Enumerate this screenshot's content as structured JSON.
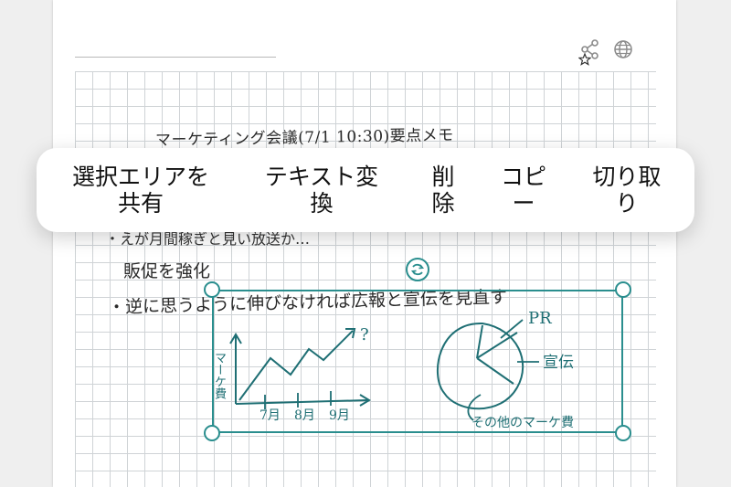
{
  "note": {
    "title": "マーケティング会議(7/1 10:30)要点メモ",
    "line_note_1": "・えが月間稼ぎと見い放送か…",
    "line_note_2": "販促を強化",
    "line_note_3": "・逆に思うように伸びなければ広報と宣伝を見直す"
  },
  "toolbar": {
    "share_icon": "share-icon",
    "globe_icon": "globe-icon"
  },
  "context_menu": {
    "items": [
      {
        "id": "share-selection",
        "label": "選択エリアを\n共有"
      },
      {
        "id": "convert-text",
        "label": "テキスト変\n換"
      },
      {
        "id": "delete",
        "label": "削\n除"
      },
      {
        "id": "copy",
        "label": "コピ\nー"
      },
      {
        "id": "cut",
        "label": "切り取\nり"
      }
    ]
  },
  "sketch": {
    "y_label": "マーケ費",
    "question": "?",
    "months": [
      "7月",
      "8月",
      "9月"
    ],
    "pie_labels": [
      "PR",
      "宣伝",
      "その他のマーケ費"
    ]
  },
  "colors": {
    "accent": "#2a8e8e",
    "ink": "#1f6f74"
  }
}
